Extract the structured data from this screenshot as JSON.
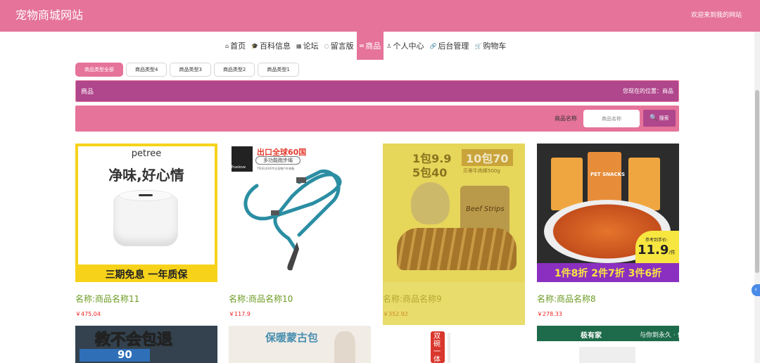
{
  "header": {
    "site_title": "宠物商城网站",
    "welcome": "欢迎来到我的网站"
  },
  "nav": [
    {
      "label": "首页",
      "icon": "home-icon",
      "glyph": "⌂"
    },
    {
      "label": "百科信息",
      "icon": "graduation-cap-icon",
      "glyph": "🎓"
    },
    {
      "label": "论坛",
      "icon": "forum-icon",
      "glyph": "▦"
    },
    {
      "label": "留言版",
      "icon": "message-icon",
      "glyph": "◌"
    },
    {
      "label": "商品",
      "icon": "envelope-icon",
      "glyph": "✉"
    },
    {
      "label": "个人中心",
      "icon": "user-icon",
      "glyph": "♙"
    },
    {
      "label": "后台管理",
      "icon": "link-icon",
      "glyph": "🔗"
    },
    {
      "label": "购物车",
      "icon": "cart-icon",
      "glyph": "🛒"
    }
  ],
  "type_tabs": [
    "商品类型全部",
    "商品类型4",
    "商品类型3",
    "商品类型2",
    "商品类型1"
  ],
  "breadcrumb": {
    "title": "商品",
    "position": "您现在的位置：商品"
  },
  "search": {
    "label": "商品名称",
    "placeholder": "商品名称",
    "button": "搜索"
  },
  "products": [
    {
      "name": "名称:商品名称11",
      "price": "￥475.04",
      "img": {
        "brand": "petree",
        "headline": "净味,好心情",
        "footer": "三期免息   一年质保"
      }
    },
    {
      "name": "名称:商品名称10",
      "price": "￥117.9",
      "img": {
        "brand": "Truelove",
        "headline": "出口全球60国",
        "sub": "多功能跑步绳",
        "small": "TRUELOVE专业宠物户外装备"
      }
    },
    {
      "name": "名称:商品名称9",
      "price": "￥352.92",
      "img": {
        "badge": "1包9.9",
        "badge2": "5包40",
        "badge3": "10包70",
        "sub": "贝蒂牛肉棒500g",
        "label": "Beef Strips"
      }
    },
    {
      "name": "名称:商品名称8",
      "price": "￥278.33",
      "img": {
        "pack": "PET SNACKS",
        "note": "参考到手价:",
        "price_big": "11.9",
        "unit": "/件",
        "footer": "1件8折 2件7折 3件6折"
      }
    }
  ],
  "row2": [
    {
      "text": "教不会包退",
      "badge": "90"
    },
    {
      "text": "保暖蒙古包"
    },
    {
      "text": "双碗一体"
    },
    {
      "brand": "极有家",
      "text": "与你到永久 · 伍佰"
    }
  ],
  "colors": {
    "primary": "#e5739a",
    "accent": "#b0468c",
    "name_green": "#6b9b22",
    "price_red": "#ee2222"
  }
}
